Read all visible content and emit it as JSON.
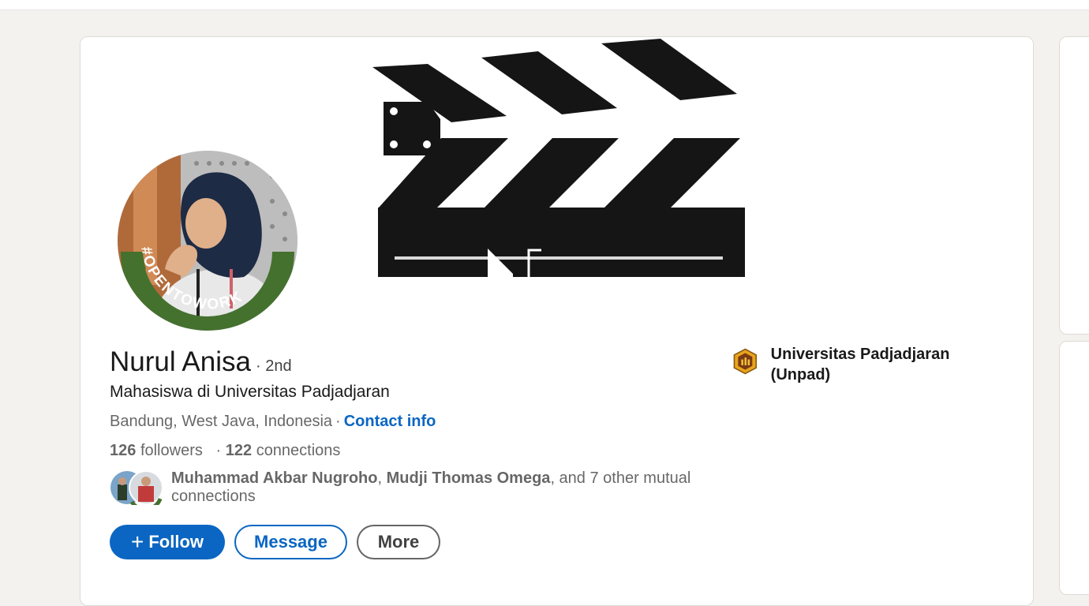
{
  "profile": {
    "name": "Nurul Anisa",
    "degree": "· 2nd",
    "headline": "Mahasiswa di Universitas Padjadjaran",
    "location": "Bandung, West Java, Indonesia",
    "contact_label": "Contact info",
    "followers_count": "126",
    "followers_label": "followers",
    "connections_count": "122",
    "connections_label": "connections",
    "open_to_work_badge": "#OPENTOWORK"
  },
  "mutual": {
    "name1": "Muhammad Akbar Nugroho",
    "name2": "Mudji Thomas Omega",
    "suffix": ", and 7 other mutual connections"
  },
  "actions": {
    "follow": "Follow",
    "message": "Message",
    "more": "More"
  },
  "education": {
    "school": "Universitas Padjadjaran (Unpad)"
  },
  "colors": {
    "brand_blue": "#0a66c2",
    "open_to_work_green": "#44712e"
  },
  "icons": {
    "follow": "plus-icon",
    "school": "university-logo-icon",
    "banner": "clapperboard-icon"
  }
}
